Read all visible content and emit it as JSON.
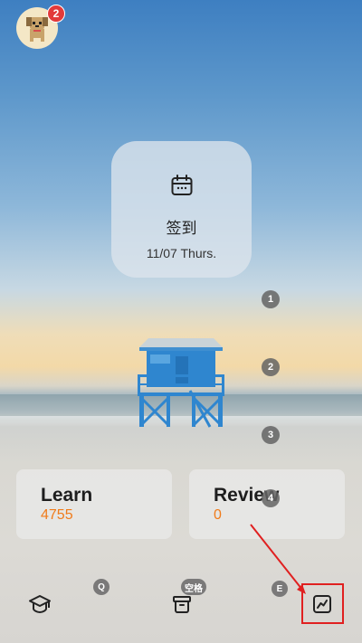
{
  "avatar": {
    "notification_count": "2"
  },
  "checkin": {
    "title": "签到",
    "date": "11/07 Thurs."
  },
  "steps": [
    "1",
    "2",
    "3",
    "4"
  ],
  "stats": {
    "learn": {
      "label": "Learn",
      "value": "4755"
    },
    "review": {
      "label": "Review",
      "value": "0"
    }
  },
  "tabbar": {
    "learn_tab": {
      "icon": "graduation-cap-icon",
      "key_hint": "Q"
    },
    "box_tab": {
      "icon": "archive-box-icon",
      "key_hint": "空格"
    },
    "stats_tab": {
      "icon": "line-chart-icon",
      "key_hint": "E"
    }
  },
  "colors": {
    "stat_value": "#f07b1a",
    "badge_red": "#e23a3a",
    "highlight": "#e02020"
  }
}
